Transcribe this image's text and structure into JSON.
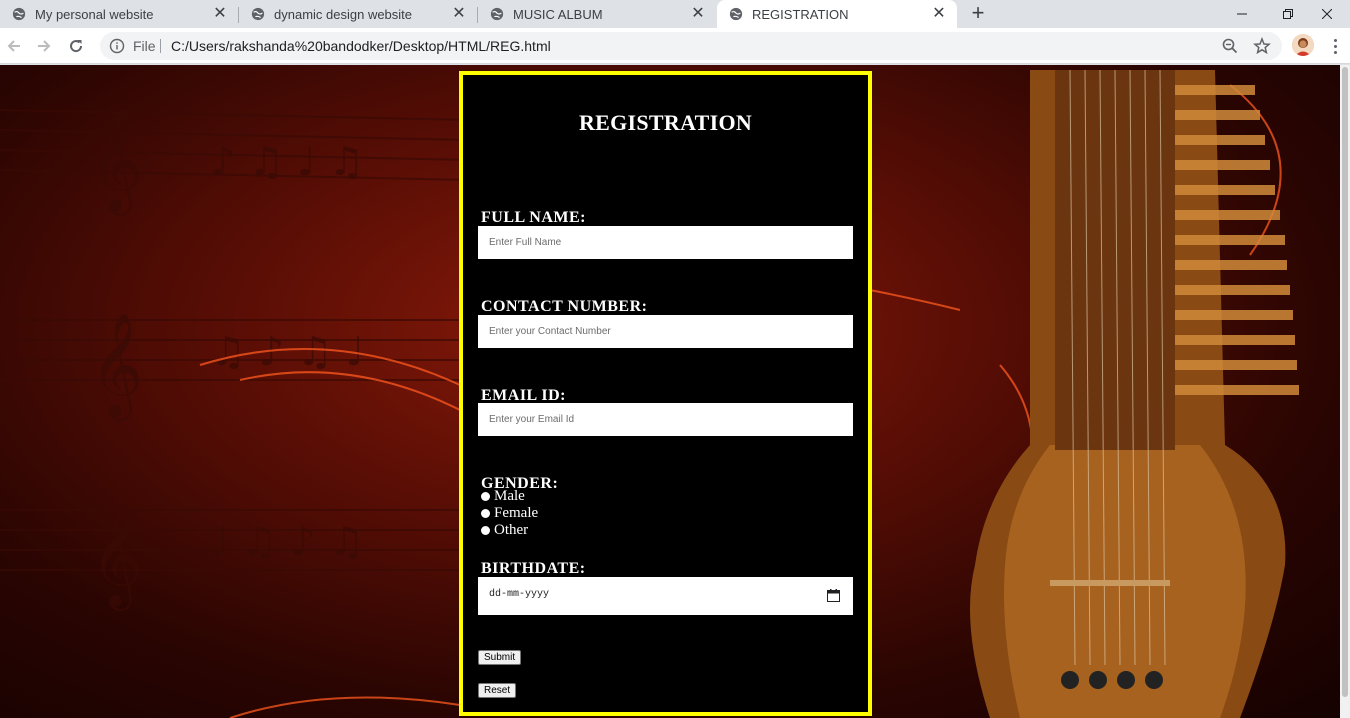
{
  "browser": {
    "tabs": [
      {
        "title": "My personal website"
      },
      {
        "title": "dynamic design website"
      },
      {
        "title": "MUSIC ALBUM"
      },
      {
        "title": "REGISTRATION"
      }
    ],
    "new_tab": "+",
    "omnibox": {
      "scheme_label": "File",
      "url": "C:/Users/rakshanda%20bandodker/Desktop/HTML/REG.html"
    }
  },
  "form": {
    "title": "REGISTRATION",
    "full_name": {
      "label": "FULL NAME:",
      "placeholder": "Enter Full Name"
    },
    "contact": {
      "label": "CONTACT NUMBER:",
      "placeholder": "Enter your Contact Number"
    },
    "email": {
      "label": "EMAIL ID:",
      "placeholder": "Enter your Email Id"
    },
    "gender": {
      "label": "GENDER:",
      "options": [
        "Male",
        "Female",
        "Other"
      ]
    },
    "birthdate": {
      "label": "BIRTHDATE:",
      "placeholder": "dd-mm-yyyy"
    },
    "submit_label": "Submit",
    "reset_label": "Reset"
  },
  "colors": {
    "form_border": "#ffff00",
    "form_background": "#000000"
  }
}
